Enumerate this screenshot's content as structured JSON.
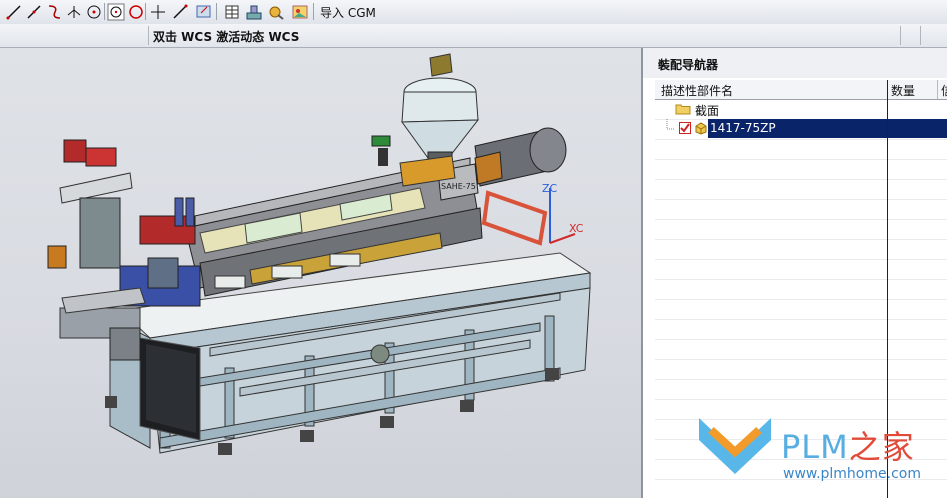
{
  "toolbar": {
    "icons": [
      "line-icon",
      "line-angle-icon",
      "arc-icon",
      "point-icon",
      "circle-point-icon",
      "circle-icon",
      "cross-icon",
      "line-tool-icon",
      "view-icon",
      "grid-icon",
      "assembly-icon",
      "gear-tool-icon",
      "picture-icon"
    ],
    "import_label": "导入 CGM"
  },
  "status": {
    "text": "双击 WCS 激活动态 WCS"
  },
  "viewport": {
    "axes": {
      "zc": "ZC",
      "xc": "XC"
    },
    "label_plate": "SAHE-75",
    "colors": {
      "frame": "#9fb5c2",
      "barrel": "#8d8f94",
      "accent_yellow": "#e7e3b8",
      "accent_green": "#d9ebd0",
      "motor": "#6b6e75",
      "hopper": "#dfe9ec",
      "highlight": "#d9533a"
    }
  },
  "navigator": {
    "title": "装配导航器",
    "pin_icon": "pin-icon",
    "columns": {
      "name": "描述性部件名",
      "qty": "数量",
      "info": "信"
    },
    "rows": [
      {
        "label": "截面",
        "type": "folder"
      },
      {
        "label": "1417-75ZP",
        "type": "part",
        "checked": true,
        "selected": true
      }
    ]
  },
  "watermark": {
    "brand": "PLM",
    "brand_cn": "之家",
    "url": "www.plmhome.com"
  }
}
